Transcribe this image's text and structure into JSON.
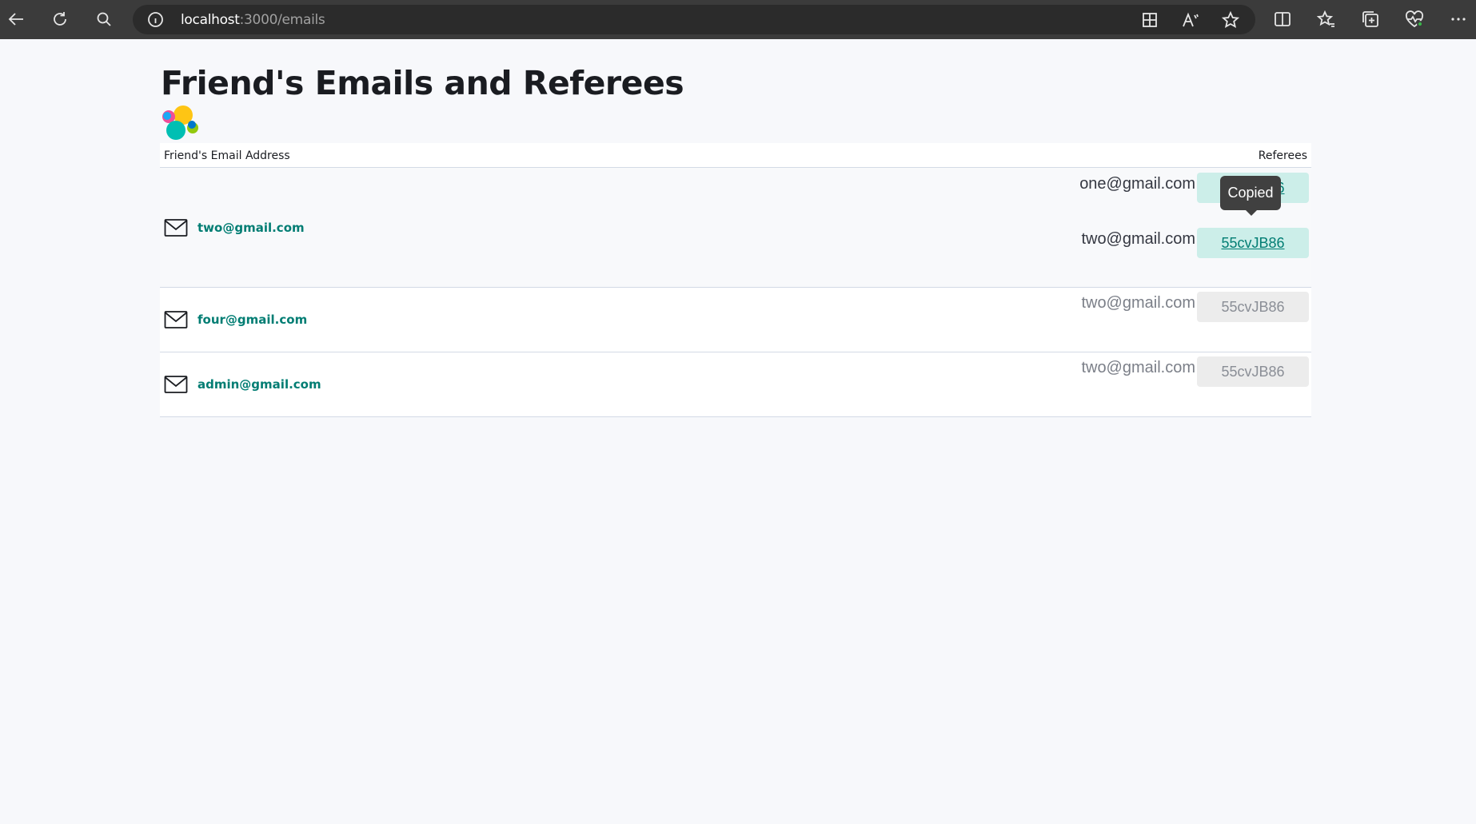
{
  "browser": {
    "url_host": "localhost",
    "url_path": ":3000/emails",
    "icons": [
      "back-arrow-icon",
      "refresh-icon",
      "search-icon",
      "site-info-icon",
      "app-available-icon",
      "read-aloud-icon",
      "favorite-star-icon",
      "split-screen-icon",
      "favorites-icon",
      "collections-icon",
      "browser-essentials-icon",
      "more-options-icon"
    ]
  },
  "page": {
    "title": "Friend's Emails and Referees",
    "logo_icon": "logo-icon"
  },
  "table": {
    "headers": {
      "email": "Friend's Email Address",
      "referees": "Referees"
    },
    "rows": [
      {
        "email": "two@gmail.com",
        "referees": [
          {
            "email": "one@gmail.com",
            "code": "55cvJB86",
            "enabled": true
          },
          {
            "email": "two@gmail.com",
            "code": "55cvJB86",
            "enabled": true
          }
        ]
      },
      {
        "email": "four@gmail.com",
        "referees": [
          {
            "email": "two@gmail.com",
            "code": "55cvJB86",
            "enabled": false
          }
        ]
      },
      {
        "email": "admin@gmail.com",
        "referees": [
          {
            "email": "two@gmail.com",
            "code": "55cvJB86",
            "enabled": false
          }
        ]
      }
    ]
  },
  "tooltip": {
    "text": "Copied"
  },
  "colors": {
    "accent": "#017d73",
    "accent_bg": "#cceee9",
    "disabled_bg": "#ececec"
  }
}
